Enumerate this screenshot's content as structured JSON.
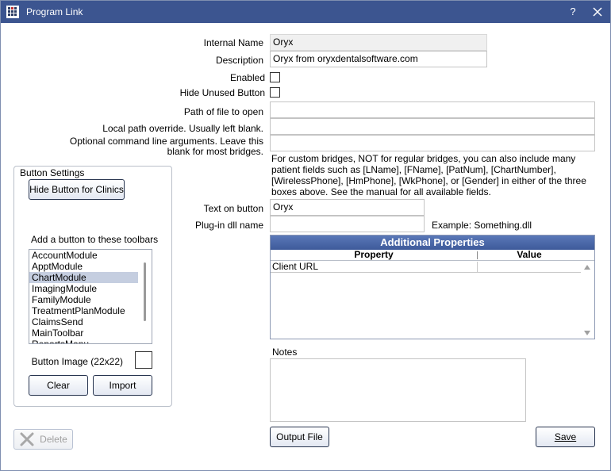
{
  "window": {
    "title": "Program Link",
    "help_glyph": "?",
    "icons": {
      "app": "grid-app-icon",
      "close": "close-icon"
    }
  },
  "form": {
    "internal_name_label": "Internal Name",
    "internal_name_value": "Oryx",
    "description_label": "Description",
    "description_value": "Oryx from oryxdentalsoftware.com",
    "enabled_label": "Enabled",
    "enabled_checked": false,
    "hide_unused_label": "Hide Unused Button",
    "hide_unused_checked": false,
    "path_label": "Path of file to open",
    "path_value": "",
    "local_path_label": "Local path override.  Usually left blank.",
    "local_path_value": "",
    "cmd_args_label_line1": "Optional command line arguments.  Leave this",
    "cmd_args_label_line2": "blank for most bridges.",
    "cmd_args_value": "",
    "custom_bridge_note": "For custom bridges, NOT for regular bridges, you can also include many patient fields such as [LName], [FName], [PatNum], [ChartNumber], [WirelessPhone], [HmPhone], [WkPhone], or [Gender] in either of the three boxes above. See the manual for all available fields.",
    "text_on_button_label": "Text on button",
    "text_on_button_value": "Oryx",
    "plugin_label": "Plug-in dll name",
    "plugin_value": "",
    "plugin_example": "Example: Something.dll"
  },
  "button_settings": {
    "group_title": "Button Settings",
    "hide_for_clinics_label": "Hide Button for Clinics",
    "toolbars_label": "Add a button to these toolbars",
    "toolbars": [
      "AccountModule",
      "ApptModule",
      "ChartModule",
      "ImagingModule",
      "FamilyModule",
      "TreatmentPlanModule",
      "ClaimsSend",
      "MainToolbar",
      "ReportsMenu"
    ],
    "selected_toolbar": "ChartModule",
    "button_image_label": "Button Image (22x22)",
    "clear_label": "Clear",
    "import_label": "Import"
  },
  "properties": {
    "title": "Additional Properties",
    "columns": [
      "Property",
      "Value"
    ],
    "rows": [
      {
        "property": "Client URL",
        "value": ""
      }
    ]
  },
  "notes": {
    "label": "Notes",
    "value": ""
  },
  "footer": {
    "delete_label": "Delete",
    "output_file_label": "Output File",
    "save_label": "Save"
  },
  "colors": {
    "titlebar": "#3c5590",
    "grid_header": "#4a68a8",
    "list_selection": "#c5cee0"
  }
}
